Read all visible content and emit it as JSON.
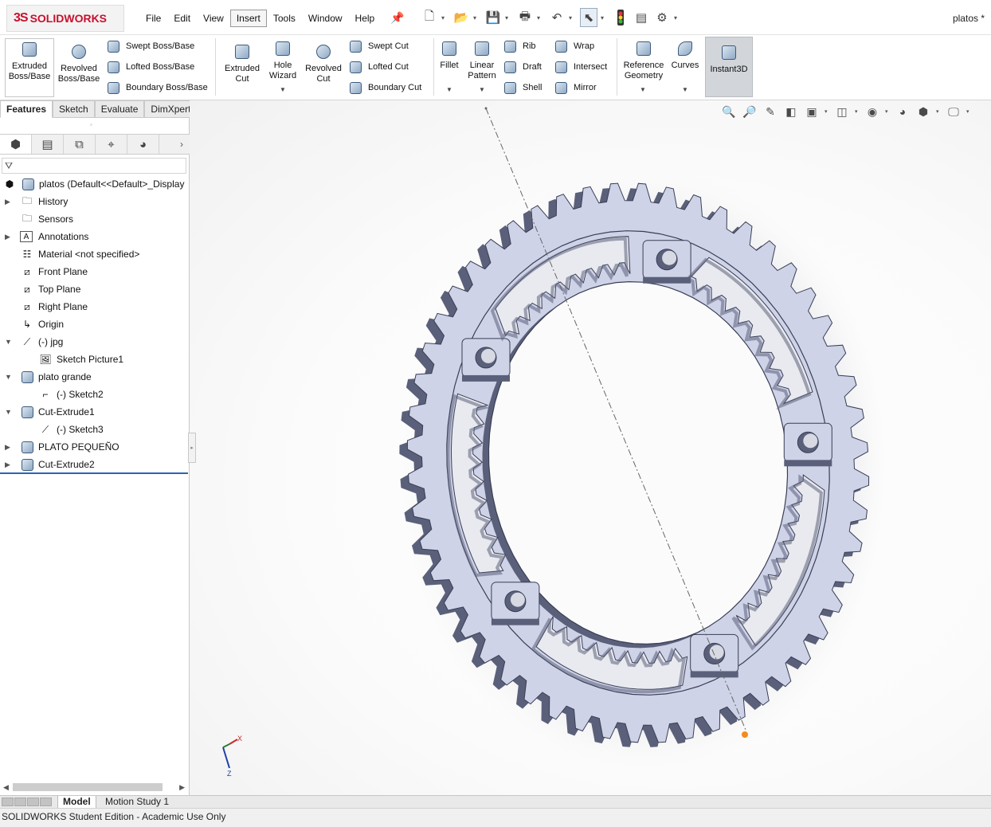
{
  "app": {
    "logo_ds": "3S",
    "logo_text": "SOLIDWORKS",
    "doc_title": "platos *"
  },
  "menu": [
    "File",
    "Edit",
    "View",
    "Insert",
    "Tools",
    "Window",
    "Help"
  ],
  "ribbon": {
    "extruded_boss": "Extruded Boss/Base",
    "revolved_boss": "Revolved Boss/Base",
    "swept_boss": "Swept Boss/Base",
    "lofted_boss": "Lofted Boss/Base",
    "boundary_boss": "Boundary Boss/Base",
    "extruded_cut": "Extruded Cut",
    "hole_wizard": "Hole Wizard",
    "revolved_cut": "Revolved Cut",
    "swept_cut": "Swept Cut",
    "lofted_cut": "Lofted Cut",
    "boundary_cut": "Boundary Cut",
    "fillet": "Fillet",
    "linear_pattern": "Linear Pattern",
    "rib": "Rib",
    "draft": "Draft",
    "shell": "Shell",
    "wrap": "Wrap",
    "intersect": "Intersect",
    "mirror": "Mirror",
    "reference_geometry": "Reference Geometry",
    "curves": "Curves",
    "instant3d": "Instant3D"
  },
  "cm_tabs": [
    "Features",
    "Sketch",
    "Evaluate",
    "DimXpert"
  ],
  "tree": {
    "root": "platos  (Default<<Default>_Display",
    "history": "History",
    "sensors": "Sensors",
    "annotations": "Annotations",
    "material": "Material <not specified>",
    "front_plane": "Front Plane",
    "top_plane": "Top Plane",
    "right_plane": "Right Plane",
    "origin": "Origin",
    "jpg": "(-) jpg",
    "sketch_picture": "Sketch Picture1",
    "plato_grande": "plato grande",
    "sketch2": "(-) Sketch2",
    "cut_extrude1": "Cut-Extrude1",
    "sketch3": "(-) Sketch3",
    "plato_pequeno": "PLATO PEQUEÑO",
    "cut_extrude2": "Cut-Extrude2"
  },
  "bottom_tabs": {
    "model": "Model",
    "motion": "Motion Study 1"
  },
  "status": "SOLIDWORKS Student Edition - Academic Use Only",
  "triad": {
    "x": "X",
    "z": "Z"
  },
  "colors": {
    "accent": "#2b63b8",
    "brand_red": "#c8102e",
    "part_face": "#cfd3e8",
    "part_side": "#5b607a"
  }
}
